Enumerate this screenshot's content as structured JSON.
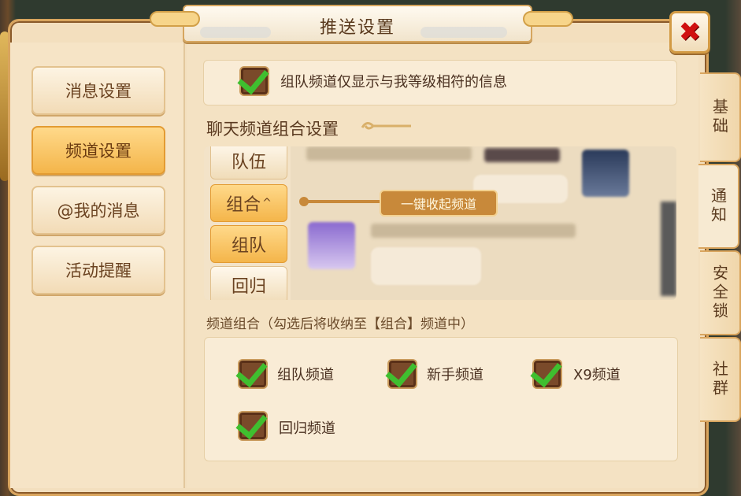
{
  "window": {
    "title": "推送设置",
    "close_symbol": "✖"
  },
  "sidebar": {
    "items": [
      {
        "label": "消息设置",
        "active": false
      },
      {
        "label": "频道设置",
        "active": true
      },
      {
        "label": "@我的消息",
        "active": false
      },
      {
        "label": "活动提醒",
        "active": false
      }
    ]
  },
  "top_option": {
    "label": "组队频道仅显示与我等级相符的信息",
    "checked": true
  },
  "section": {
    "heading": "聊天频道组合设置"
  },
  "preview": {
    "channels": [
      {
        "label": "队伍",
        "selected": false
      },
      {
        "label": "组合",
        "selected": true,
        "indicator": "^"
      },
      {
        "label": "组队",
        "selected": true
      },
      {
        "label": "回归",
        "selected": false
      }
    ],
    "collapse_tag": "一键收起频道"
  },
  "combo": {
    "description": "频道组合（勾选后将收纳至【组合】频道中）",
    "options": [
      {
        "label": "组队频道",
        "checked": true
      },
      {
        "label": "新手频道",
        "checked": true
      },
      {
        "label": "X9频道",
        "checked": true
      },
      {
        "label": "回归频道",
        "checked": true
      }
    ]
  },
  "side_tabs": [
    {
      "label": "基础",
      "active": false
    },
    {
      "label": "通知",
      "active": true
    },
    {
      "label": "安全锁",
      "active": false
    },
    {
      "label": "社群",
      "active": false
    }
  ],
  "colors": {
    "accent": "#f4b54a",
    "check": "#3fbf2f",
    "close": "#d01010",
    "panel": "#f4e2c3"
  }
}
